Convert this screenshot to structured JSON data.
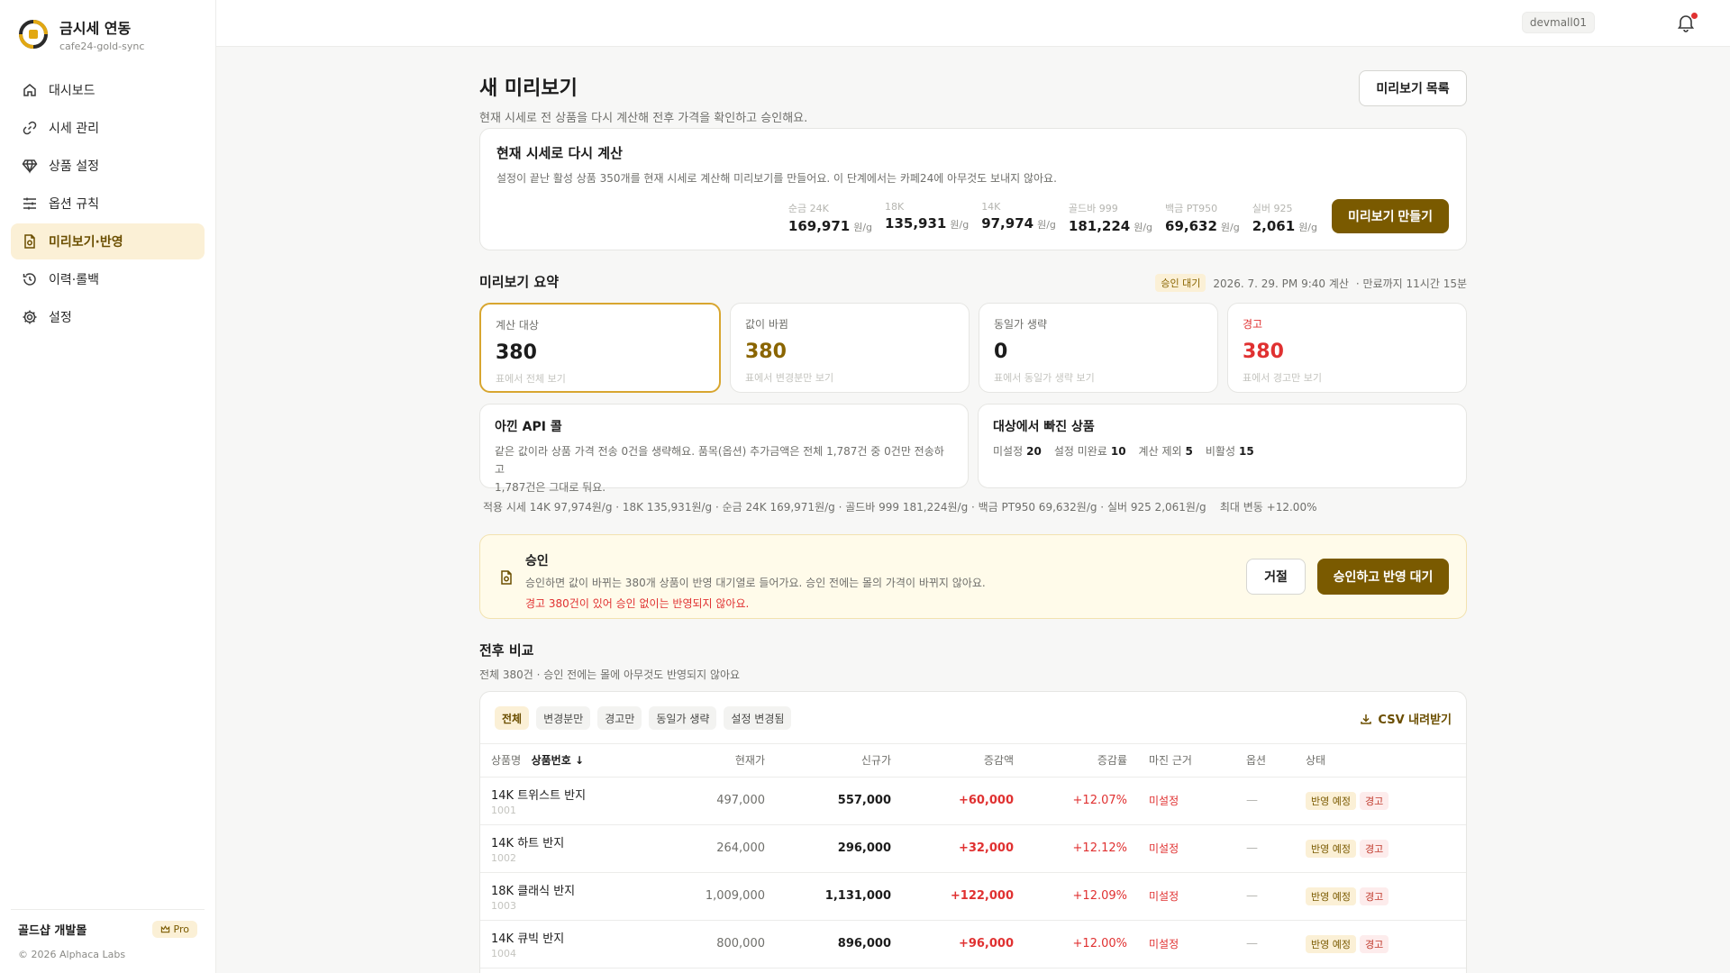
{
  "brand": {
    "title": "금시세 연동",
    "subtitle": "cafe24-gold-sync"
  },
  "nav": [
    {
      "label": "대시보드",
      "icon": "home-icon"
    },
    {
      "label": "시세 관리",
      "icon": "link-icon"
    },
    {
      "label": "상품 설정",
      "icon": "diamond-icon"
    },
    {
      "label": "옵션 규칙",
      "icon": "sliders-icon"
    },
    {
      "label": "미리보기·반영",
      "icon": "file-check-icon",
      "active": true
    },
    {
      "label": "이력·롤백",
      "icon": "history-icon"
    },
    {
      "label": "설정",
      "icon": "gear-icon"
    }
  ],
  "footer": {
    "shop": "골드샵 개발몰",
    "plan": "Pro",
    "copyright": "© 2026 Alphaca Labs"
  },
  "topbar": {
    "user": "devmall01"
  },
  "page": {
    "title": "새 미리보기",
    "desc": "현재 시세로 전 상품을 다시 계산해 전후 가격을 확인하고 승인해요.",
    "list_button": "미리보기 목록"
  },
  "recalc": {
    "title": "현재 시세로 다시 계산",
    "desc": "설정이 끝난 활성 상품 350개를 현재 시세로 계산해 미리보기를 만들어요. 이 단계에서는 카페24에 아무것도 보내지 않아요.",
    "unit": "원/g",
    "prices": [
      {
        "label": "순금 24K",
        "value": "169,971"
      },
      {
        "label": "18K",
        "value": "135,931"
      },
      {
        "label": "14K",
        "value": "97,974"
      },
      {
        "label": "골드바 999",
        "value": "181,224"
      },
      {
        "label": "백금 PT950",
        "value": "69,632"
      },
      {
        "label": "실버 925",
        "value": "2,061"
      }
    ],
    "button": "미리보기 만들기"
  },
  "summary": {
    "title": "미리보기 요약",
    "status": "승인 대기",
    "computed": "2026. 7. 29. PM 9:40 계산",
    "expires": "· 만료까지 11시간 15분",
    "stats": [
      {
        "label": "계산 대상",
        "value": "380",
        "link": "표에서 전체 보기",
        "color": "#1c1c1c",
        "label_color": "#6f6f6b",
        "selected": true
      },
      {
        "label": "값이 바뀜",
        "value": "380",
        "link": "표에서 변경분만 보기",
        "color": "#8a6500",
        "label_color": "#6f6f6b"
      },
      {
        "label": "동일가 생략",
        "value": "0",
        "link": "표에서 동일가 생략 보기",
        "color": "#1c1c1c",
        "label_color": "#6f6f6b"
      },
      {
        "label": "경고",
        "value": "380",
        "link": "표에서 경고만 보기",
        "color": "#e03131",
        "label_color": "#e03131"
      }
    ],
    "api": {
      "title": "아낀 API 콜",
      "line1": "같은 값이라 상품 가격 전송 0건을 생략해요. 품목(옵션) 추가금액은 전체 1,787건 중 0건만 전송하고",
      "line2": "1,787건은 그대로 둬요."
    },
    "excluded": {
      "title": "대상에서 빠진 상품",
      "items": [
        {
          "label": "미설정",
          "value": "20"
        },
        {
          "label": "설정 미완료",
          "value": "10"
        },
        {
          "label": "계산 제외",
          "value": "5"
        },
        {
          "label": "비활성",
          "value": "15"
        }
      ]
    },
    "applied": "적용 시세 14K 97,974원/g · 18K 135,931원/g · 순금 24K 169,971원/g · 골드바 999 181,224원/g · 백금 PT950 69,632원/g · 실버 925 2,061원/g",
    "max_change": "최대 변동 +12.00%"
  },
  "approve": {
    "title": "승인",
    "desc": "승인하면 값이 바뀌는 380개 상품이 반영 대기열로 들어가요. 승인 전에는 몰의 가격이 바뀌지 않아요.",
    "warn": "경고 380건이 있어 승인 없이는 반영되지 않아요.",
    "reject": "거절",
    "confirm": "승인하고 반영 대기"
  },
  "compare": {
    "title": "전후 비교",
    "desc": "전체 380건 · 승인 전에는 몰에 아무것도 반영되지 않아요",
    "filters": [
      "전체",
      "변경분만",
      "경고만",
      "동일가 생략",
      "설정 변경됨"
    ],
    "csv": "CSV 내려받기",
    "columns": {
      "name": "상품명",
      "sort": "상품번호",
      "current": "현재가",
      "new": "신규가",
      "diff": "증감액",
      "rate": "증감률",
      "margin": "마진 근거",
      "option": "옵션",
      "status": "상태"
    },
    "rows": [
      {
        "name": "14K 트위스트 반지",
        "id": "1001",
        "current": "497,000",
        "new": "557,000",
        "diff": "+60,000",
        "rate": "+12.07%",
        "margin": "미설정",
        "option": "—",
        "tag1": "반영 예정",
        "tag2": "경고"
      },
      {
        "name": "14K 하트 반지",
        "id": "1002",
        "current": "264,000",
        "new": "296,000",
        "diff": "+32,000",
        "rate": "+12.12%",
        "margin": "미설정",
        "option": "—",
        "tag1": "반영 예정",
        "tag2": "경고"
      },
      {
        "name": "18K 클래식 반지",
        "id": "1003",
        "current": "1,009,000",
        "new": "1,131,000",
        "diff": "+122,000",
        "rate": "+12.09%",
        "margin": "미설정",
        "option": "—",
        "tag1": "반영 예정",
        "tag2": "경고"
      },
      {
        "name": "14K 큐빅 반지",
        "id": "1004",
        "current": "800,000",
        "new": "896,000",
        "diff": "+96,000",
        "rate": "+12.00%",
        "margin": "미설정",
        "option": "—",
        "tag1": "반영 예정",
        "tag2": "경고"
      }
    ]
  },
  "colors": {
    "accent": "#7a5a00",
    "accent_soft": "#fbf0d6",
    "danger": "#e03131",
    "selected_border": "#d8a630"
  }
}
